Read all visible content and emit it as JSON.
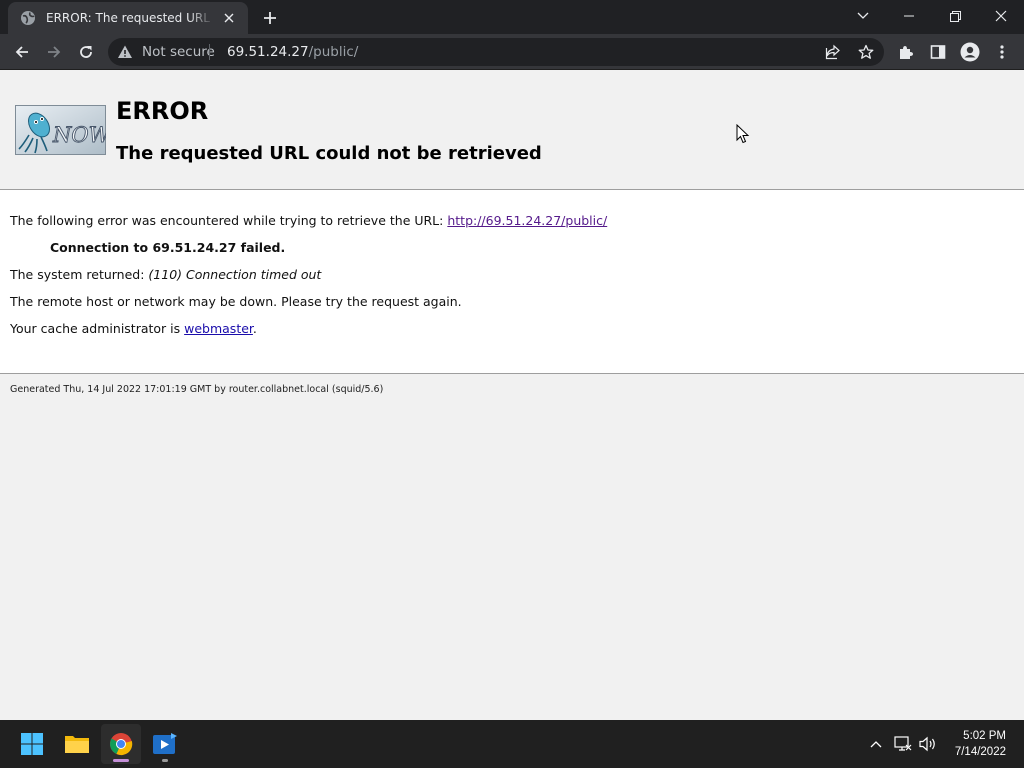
{
  "browser": {
    "tab_title": "ERROR: The requested URL could not be retrieved",
    "security_label": "Not secure",
    "url_host": "69.51.24.27",
    "url_path": "/public/",
    "colors": {
      "frame": "#202124",
      "toolbar": "#35363a",
      "omnibox": "#202124"
    }
  },
  "page": {
    "title": "ERROR",
    "subtitle": "The requested URL could not be retrieved",
    "intro": "The following error was encountered while trying to retrieve the URL: ",
    "url_link": "http://69.51.24.27/public/",
    "connection_failed": "Connection to 69.51.24.27 failed.",
    "system_returned_label": "The system returned: ",
    "system_returned_value": "(110) Connection timed out",
    "remote_host_msg": "The remote host or network may be down. Please try the request again.",
    "cache_admin_prefix": "Your cache administrator is ",
    "cache_admin_link": "webmaster",
    "cache_admin_suffix": ".",
    "generated": "Generated Thu, 14 Jul 2022 17:01:19 GMT by router.collabnet.local (squid/5.6)",
    "logo_text": "NOW"
  },
  "taskbar": {
    "apps": [
      "windows-start",
      "file-explorer",
      "chrome",
      "media-player"
    ],
    "time": "5:02 PM",
    "date": "7/14/2022"
  }
}
